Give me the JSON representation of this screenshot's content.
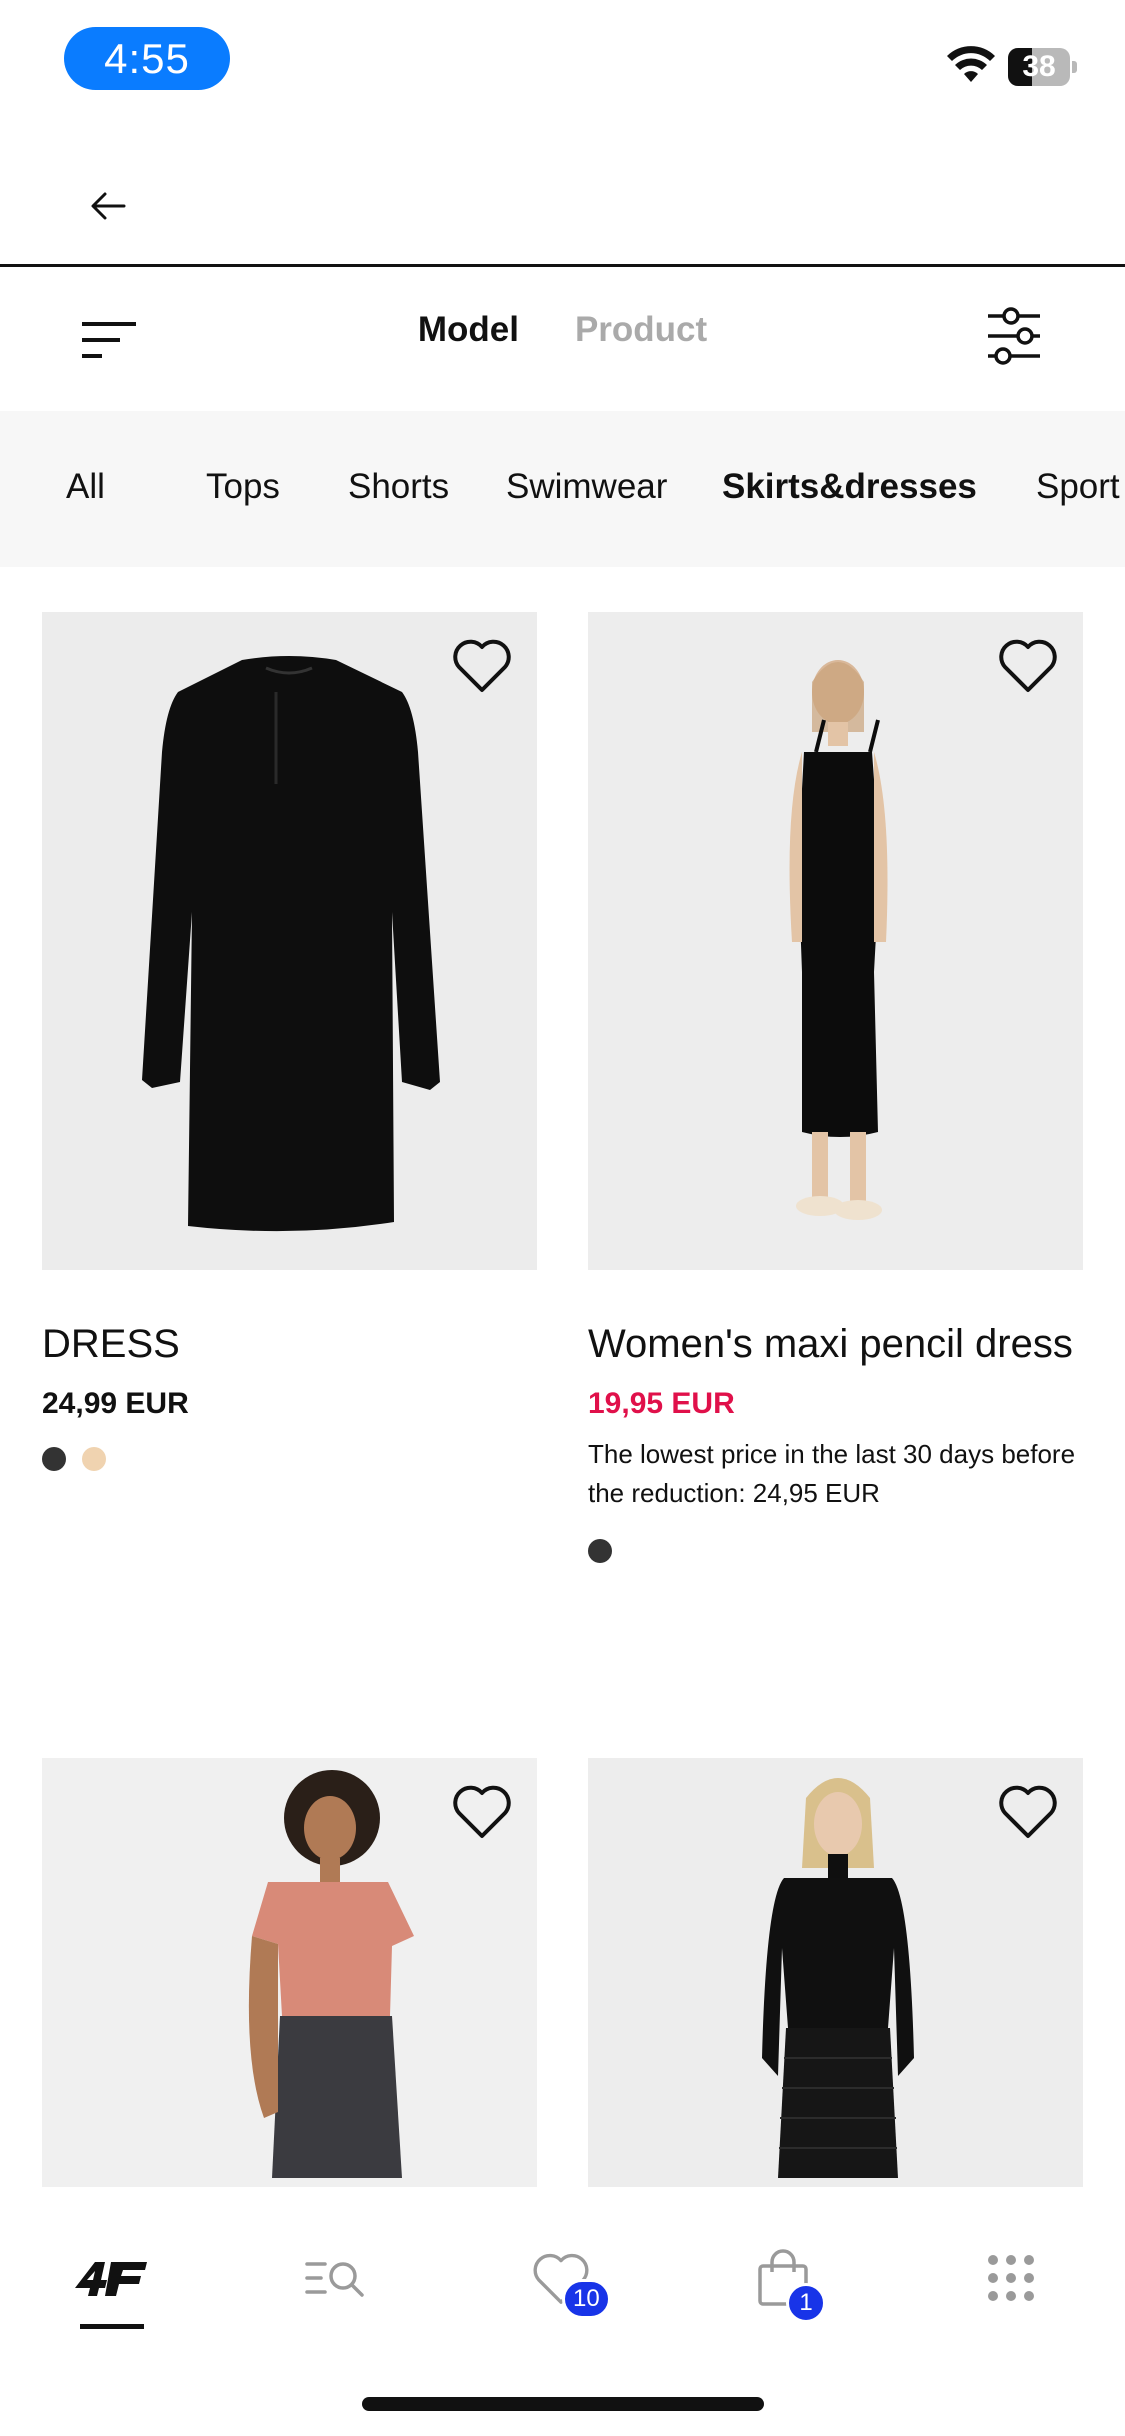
{
  "status_bar": {
    "time": "4:55",
    "battery": "38",
    "battery_level": 0.38
  },
  "view_toggle": {
    "model": "Model",
    "product": "Product"
  },
  "categories": [
    "All",
    "Tops",
    "Shorts",
    "Swimwear",
    "Skirts&dresses",
    "Sport"
  ],
  "selected_category": "Skirts&dresses",
  "products": [
    {
      "name": "DRESS",
      "price": "24,99 EUR",
      "swatches": [
        "#333333",
        "#f0d3b0"
      ]
    },
    {
      "name": "Women's maxi pencil dress",
      "price": "19,95 EUR",
      "note": "The lowest price in the last 30 days before the reduction: 24,95 EUR",
      "swatches": [
        "#333333"
      ]
    },
    {
      "name": "",
      "price": ""
    },
    {
      "name": "",
      "price": ""
    }
  ],
  "tabbar": {
    "wishlist_count": "10",
    "cart_count": "1"
  },
  "colors": {
    "accent": "#0a7cff",
    "sale": "#e0104a",
    "badge": "#1834e8"
  }
}
